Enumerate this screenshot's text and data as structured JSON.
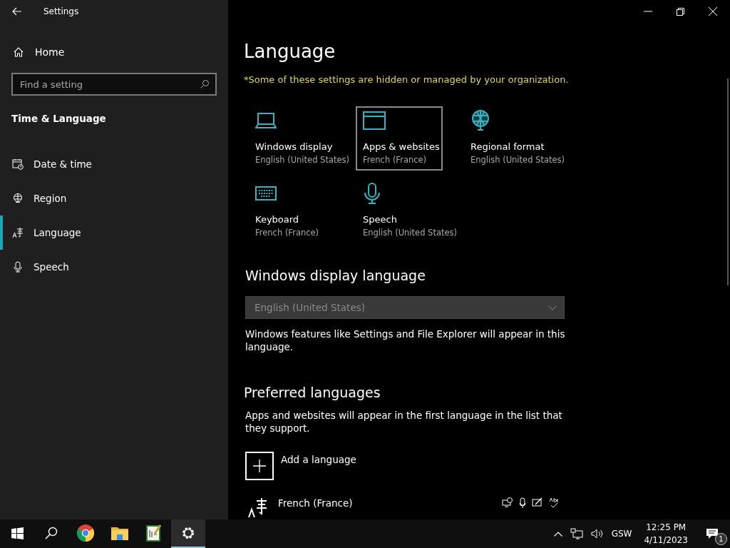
{
  "window": {
    "title": "Settings"
  },
  "sidebar": {
    "home": "Home",
    "search": {
      "placeholder": "Find a setting"
    },
    "section": "Time & Language",
    "items": [
      {
        "kind": "calendar",
        "label": "Date & time",
        "selected": false
      },
      {
        "kind": "globe",
        "label": "Region",
        "selected": false
      },
      {
        "kind": "language",
        "label": "Language",
        "selected": true
      },
      {
        "kind": "microphone",
        "label": "Speech",
        "selected": false
      }
    ]
  },
  "page": {
    "title": "Language",
    "notice": "*Some of these settings are hidden or managed by your organization.",
    "tiles": [
      {
        "kind": "laptop",
        "title": "Windows display",
        "value": "English (United States)",
        "selected": false
      },
      {
        "kind": "window",
        "title": "Apps & websites",
        "value": "French (France)",
        "selected": true
      },
      {
        "kind": "globe",
        "title": "Regional format",
        "value": "English (United States)",
        "selected": false
      },
      {
        "kind": "keyboard",
        "title": "Keyboard",
        "value": "French (France)",
        "selected": false
      },
      {
        "kind": "microphone",
        "title": "Speech",
        "value": "English (United States)",
        "selected": false
      }
    ],
    "display_language": {
      "heading": "Windows display language",
      "dropdown": {
        "value": "English (United States)",
        "disabled": true
      },
      "description": "Windows features like Settings and File Explorer will appear in this language."
    },
    "preferred": {
      "heading": "Preferred languages",
      "description": "Apps and websites will appear in the first language in the list that they support.",
      "add_label": "Add a language",
      "languages": [
        {
          "name": "French (France)"
        }
      ]
    }
  },
  "taskbar": {
    "apps": [
      {
        "kind": "start",
        "active": false
      },
      {
        "kind": "search",
        "active": false
      },
      {
        "kind": "browser",
        "active": false
      },
      {
        "kind": "folder",
        "active": false
      },
      {
        "kind": "editor",
        "active": false
      },
      {
        "kind": "settings",
        "active": true
      }
    ],
    "tray": {
      "language": "GSW",
      "time": "12:25 PM",
      "date": "4/11/2023",
      "notifications": "1"
    }
  }
}
